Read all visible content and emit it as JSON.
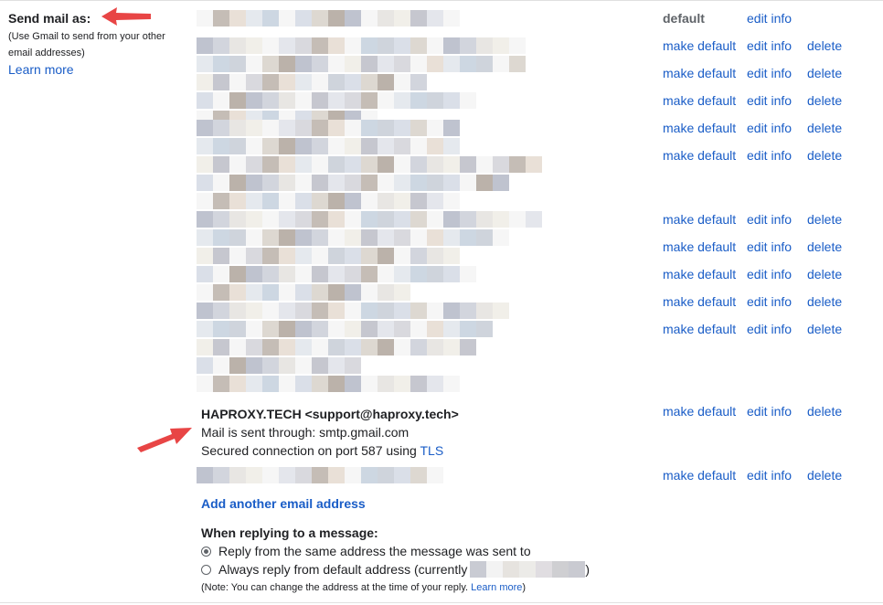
{
  "send_mail_as": {
    "heading": "Send mail as:",
    "note_line1": "(Use Gmail to send from your other",
    "note_line2": "email addresses)",
    "learn_more": "Learn more"
  },
  "rows": [
    {
      "status": "default",
      "edit": "edit info"
    },
    {
      "make": "make default",
      "edit": "edit info",
      "delete": "delete"
    },
    {
      "make": "make default",
      "edit": "edit info",
      "delete": "delete"
    },
    {
      "make": "make default",
      "edit": "edit info",
      "delete": "delete"
    },
    {
      "make": "make default",
      "edit": "edit info",
      "delete": "delete"
    },
    {
      "make": "make default",
      "edit": "edit info",
      "delete": "delete"
    },
    {
      "make": "make default",
      "edit": "edit info",
      "delete": "delete"
    },
    {
      "make": "make default",
      "edit": "edit info",
      "delete": "delete"
    },
    {
      "make": "make default",
      "edit": "edit info",
      "delete": "delete"
    },
    {
      "make": "make default",
      "edit": "edit info",
      "delete": "delete"
    },
    {
      "make": "make default",
      "edit": "edit info",
      "delete": "delete"
    },
    {
      "make": "make default",
      "edit": "edit info",
      "delete": "delete"
    },
    {
      "make": "make default",
      "edit": "edit info",
      "delete": "delete"
    }
  ],
  "haproxy": {
    "name": "HAPROXY.TECH <support@haproxy.tech>",
    "line2": "Mail is sent through: smtp.gmail.com",
    "line3_prefix": "Secured connection on port 587 using ",
    "line3_link": "TLS"
  },
  "add_another": "Add another email address",
  "replying": {
    "title": "When replying to a message:",
    "option1": "Reply from the same address the message was sent to",
    "option2": "Always reply from default address (currently",
    "option2_suffix": ")",
    "note_prefix": "(Note: You can change the address at the time of your reply. ",
    "note_link": "Learn more",
    "note_suffix": ")"
  },
  "colors": {
    "link": "#1a5dc7",
    "arrow": "#e84545"
  }
}
